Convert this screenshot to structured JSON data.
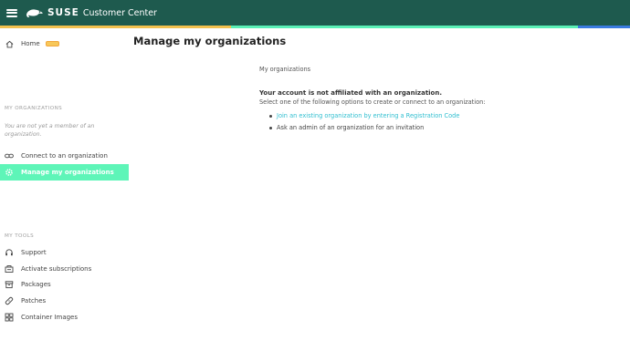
{
  "header": {
    "brand": "SUSE",
    "product": "Customer Center",
    "menu_icon": "hamburger-icon",
    "logo_icon": "chameleon-logo-icon"
  },
  "colors": {
    "header_bg": "#1e5a4e",
    "accent_yellow": "#f2c14e",
    "accent_green": "#5af0b6",
    "accent_blue": "#3a7be0",
    "active_item_bg": "#5ef5b8",
    "link": "#30bfd0"
  },
  "sidebar": {
    "home": {
      "label": "Home",
      "icon": "home-icon"
    },
    "organizations_heading": "MY ORGANIZATIONS",
    "org_note": "You are not yet a member of an organization.",
    "org_items": [
      {
        "label": "Connect to an organization",
        "icon": "link-icon"
      },
      {
        "label": "Manage my organizations",
        "icon": "gear-icon",
        "active": true
      }
    ],
    "tools_heading": "MY TOOLS",
    "tools": [
      {
        "label": "Support",
        "icon": "headset-icon"
      },
      {
        "label": "Activate subscriptions",
        "icon": "key-box-icon"
      },
      {
        "label": "Packages",
        "icon": "package-icon"
      },
      {
        "label": "Patches",
        "icon": "bandage-icon"
      },
      {
        "label": "Container Images",
        "icon": "grid-icon"
      }
    ]
  },
  "main": {
    "title": "Manage my organizations",
    "breadcrumb": "My organizations",
    "notice_title": "Your account is not affiliated with an organization.",
    "notice_text": "Select one of the following options to create or connect to an organization:",
    "options": [
      {
        "label": "Join an existing organization by entering a Registration Code",
        "is_link": true
      },
      {
        "label": "Ask an admin of an organization for an invitation",
        "is_link": false
      }
    ]
  }
}
